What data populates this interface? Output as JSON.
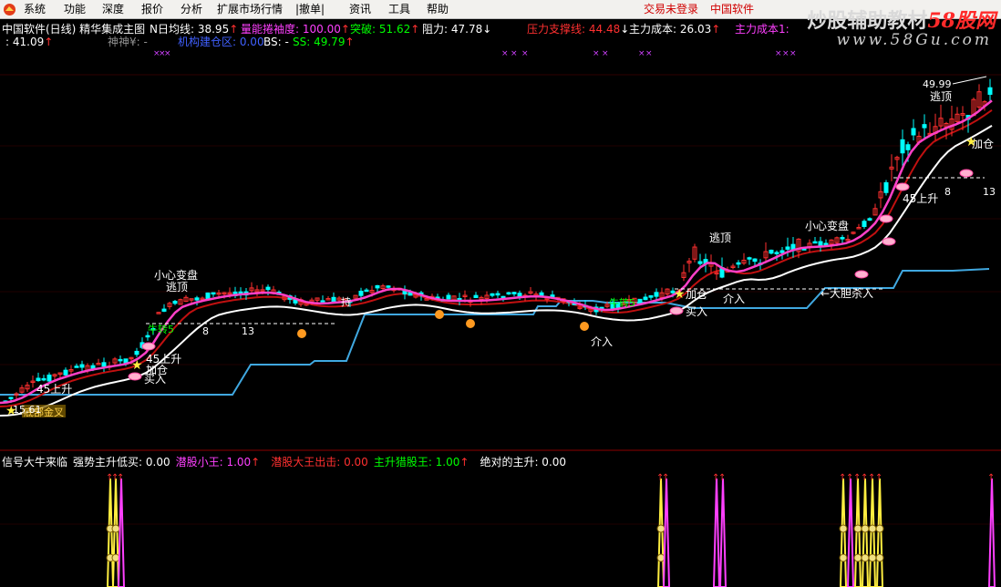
{
  "menu": {
    "items": [
      "系统",
      "功能",
      "深度",
      "报价",
      "分析",
      "扩展市场行情",
      "|撤单|",
      "资讯",
      "工具",
      "帮助"
    ],
    "login_status": "交易未登录",
    "brand_link": "中国软件"
  },
  "watermark": {
    "text": "炒股辅助教材",
    "brand": "58股网",
    "url": "www.58Gu.com"
  },
  "header": {
    "stock_title": "中国软件(日线) 精华集成主图",
    "row1": [
      {
        "label": "N日均线: ",
        "value": "38.95",
        "arrow": "↑",
        "color": "#ffffff"
      },
      {
        "label": "量能捲袖度: ",
        "value": "100.00",
        "arrow": "↑",
        "color": "#ff40ff"
      },
      {
        "label": "突破: ",
        "value": "51.62",
        "arrow": "↑",
        "color": "#00ff00"
      },
      {
        "label": "阻力: ",
        "value": "47.78",
        "arrow": "↓",
        "color": "#ffffff"
      },
      {
        "label": "压力支撑线: ",
        "value": "44.48",
        "arrow": "↓",
        "color": "#ff3030"
      },
      {
        "label": "主力成本: ",
        "value": "26.03",
        "arrow": "↑",
        "color": "#ffffff"
      },
      {
        "label": "主力成本1: ",
        "value": "",
        "arrow": "",
        "color": "#ff40ff"
      }
    ],
    "row2": [
      {
        "label": ": ",
        "value": "41.09",
        "arrow": "↑",
        "color": "#ffffff"
      },
      {
        "label": "神神¥: ",
        "value": "-",
        "arrow": "",
        "color": "#909090"
      },
      {
        "label": "机构建仓区: ",
        "value": "0.00",
        "arrow": "",
        "color": "#4060ff"
      },
      {
        "label": "BS: ",
        "value": "-",
        "arrow": "",
        "color": "#ffffff"
      },
      {
        "label": "SS: ",
        "value": "49.79",
        "arrow": "↑",
        "color": "#00ff00"
      }
    ]
  },
  "annotations": {
    "price_high": "49.99",
    "escape_top_1": "逃顶",
    "escape_top_2": "逃顶",
    "escape_top_3": "逃顶",
    "careful_1": "小心变盘",
    "careful_2": "小心变盘",
    "rise_45_1": "45上升",
    "rise_45_2": "45上升",
    "add_pos_1": "加仓",
    "add_pos_2": "加仓",
    "add_pos_3": "加仓",
    "buy_in_1": "买入",
    "buy_in_2": "买入",
    "chase_1": "追",
    "chase_2": "追",
    "chase_3": "追",
    "chase_4": "追",
    "chase_5": "追",
    "enter_1": "介入",
    "enter_2": "介入",
    "bold_buy": "←大胆杀入",
    "bull_1": "牛转5",
    "bull_2": "牛转5",
    "n8_a": "8",
    "n13_a": "13",
    "n8_b": "8",
    "n13_b": "13",
    "hold": "持",
    "low_price": "15.61",
    "cross": "底部金叉"
  },
  "bottom_panel": {
    "items": [
      {
        "label": "信号大牛来临",
        "value": "",
        "color": "#ffffff"
      },
      {
        "label": "强势主升低买: ",
        "value": "0.00",
        "color": "#ffffff"
      },
      {
        "label": "潜股小王: ",
        "value": "1.00",
        "arrow": "↑",
        "color": "#ff40ff"
      },
      {
        "label": "潜股大王出击: ",
        "value": "0.00",
        "color": "#ff3030"
      },
      {
        "label": "主升猎股王: ",
        "value": "1.00",
        "arrow": "↑",
        "color": "#00ff00"
      },
      {
        "label": "绝对的主升: ",
        "value": "0.00",
        "color": "#ffffff"
      }
    ]
  },
  "colors": {
    "bg": "#000000",
    "up_candle": "#ff3030",
    "down_candle": "#00ffff",
    "ma_magenta": "#ff40c8",
    "ma_white": "#ffffff",
    "support_blue": "#40a8e0",
    "dark_red_line": "#c01010"
  }
}
